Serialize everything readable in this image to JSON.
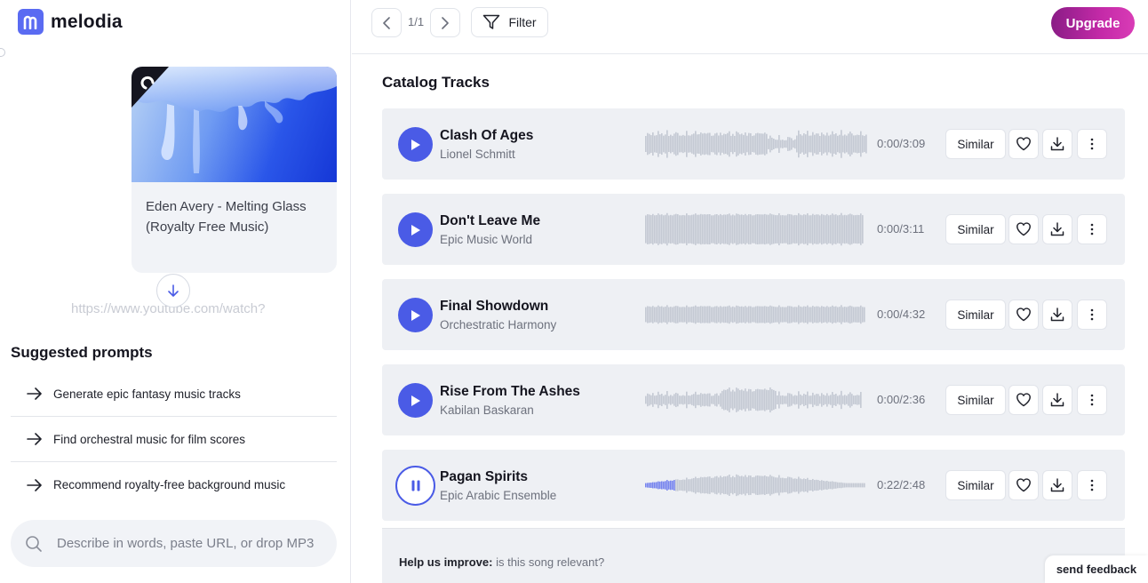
{
  "app": {
    "name": "melodia"
  },
  "chat": {
    "card_title": "Eden Avery - Melting Glass (Royalty Free Music)",
    "url_placeholder": "https://www.youtube.com/watch?",
    "suggested_title": "Suggested prompts",
    "prompts": [
      {
        "label": "Generate epic fantasy music tracks"
      },
      {
        "label": "Find orchestral music for film scores"
      },
      {
        "label": "Recommend royalty-free background music"
      }
    ],
    "input_placeholder": "Describe in words, paste URL, or drop MP3"
  },
  "toolbar": {
    "page_indicator": "1/1",
    "filter_label": "Filter",
    "upgrade_label": "Upgrade"
  },
  "catalog": {
    "title": "Catalog Tracks",
    "similar_label": "Similar",
    "tracks": [
      {
        "title": "Clash Of Ages",
        "artist": "Lionel Schmitt",
        "time": "0:00/3:09",
        "playing": false,
        "progress": 0
      },
      {
        "title": "Don't Leave Me",
        "artist": "Epic Music World",
        "time": "0:00/3:11",
        "playing": false,
        "progress": 0
      },
      {
        "title": "Final Showdown",
        "artist": "Orchestratic Harmony",
        "time": "0:00/4:32",
        "playing": false,
        "progress": 0
      },
      {
        "title": "Rise From The Ashes",
        "artist": "Kabilan Baskaran",
        "time": "0:00/2:36",
        "playing": false,
        "progress": 0
      },
      {
        "title": "Pagan Spirits",
        "artist": "Epic Arabic Ensemble",
        "time": "0:22/2:48",
        "playing": true,
        "progress": 0.13
      }
    ],
    "feedback_bold": "Help us improve:",
    "feedback_text": " is this song relevant?"
  },
  "send_feedback_label": "send feedback",
  "colors": {
    "accent": "#4a5be6",
    "waveform": "#c4c9d3",
    "waveform_played": "#7583ee",
    "upgrade_start": "#8a1c86",
    "upgrade_end": "#d93cb6",
    "logo": "#5a6bf2"
  }
}
